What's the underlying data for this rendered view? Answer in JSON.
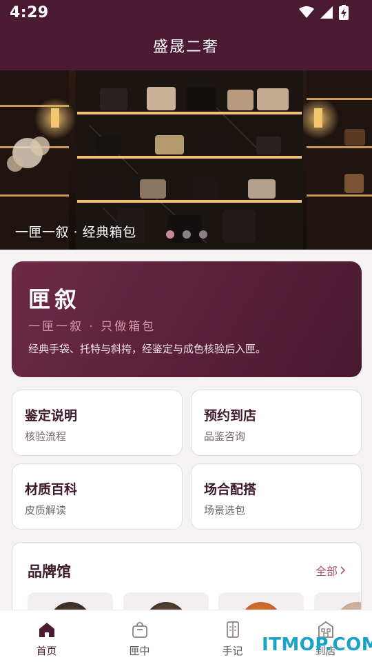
{
  "status_bar": {
    "time": "4:29",
    "icons": [
      "wifi-icon",
      "signal-icon",
      "battery-charging-icon"
    ]
  },
  "app": {
    "title": "盛晟二奢"
  },
  "banner": {
    "caption": "一匣一叙 · 经典箱包",
    "slide_count": 3,
    "active_slide": 1
  },
  "hero": {
    "title": "匣叙",
    "subtitle": "一匣一叙 · 只做箱包",
    "description": "经典手袋、托特与斜挎，经鉴定与成色核验后入匣。"
  },
  "tiles": [
    {
      "title": "鉴定说明",
      "subtitle": "核验流程"
    },
    {
      "title": "预约到店",
      "subtitle": "品鉴咨询"
    },
    {
      "title": "材质百科",
      "subtitle": "皮质解读"
    },
    {
      "title": "场合配搭",
      "subtitle": "场景选包"
    }
  ],
  "brands": {
    "title": "品牌馆",
    "more_label": "全部"
  },
  "tabbar": {
    "items": [
      {
        "label": "首页",
        "icon": "home-icon",
        "active": true
      },
      {
        "label": "匣中",
        "icon": "bag-icon",
        "active": false
      },
      {
        "label": "手记",
        "icon": "notebook-icon",
        "active": false
      },
      {
        "label": "到店",
        "icon": "store-icon",
        "active": false
      }
    ]
  },
  "watermark": {
    "text": "ITMOP.COM"
  },
  "colors": {
    "primary": "#4b1b33",
    "accent": "#a8566f",
    "hero_subtitle": "#d895a8",
    "watermark": "#1aa3c9"
  }
}
